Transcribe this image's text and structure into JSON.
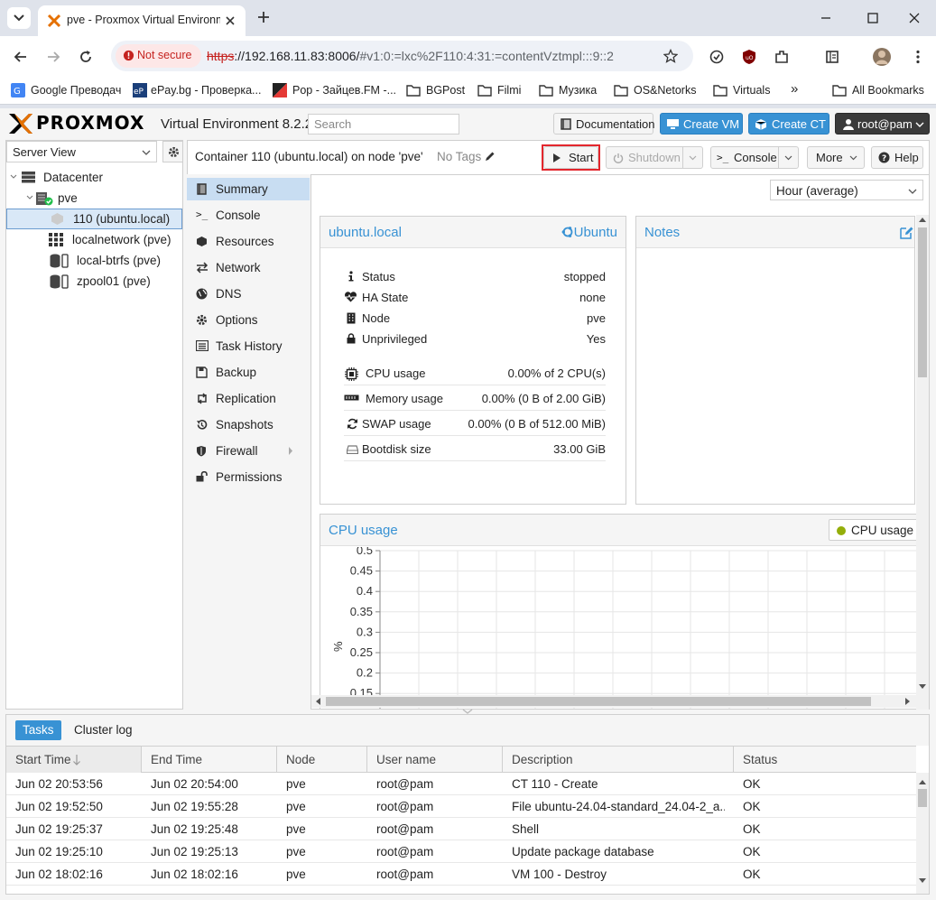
{
  "browser": {
    "tab_title": "pve - Proxmox Virtual Environm",
    "security_label": "Not secure",
    "url_scheme": "https",
    "url_host": "://192.168.11.83:8006/",
    "url_path": "#v1:0:=lxc%2F110:4:31:=contentVztmpl:::9::2",
    "bookmarks": [
      "Google Преводач",
      "ePay.bg - Проверка...",
      "Pop - Зайцев.FM -...",
      "BGPost",
      "Filmi",
      "Музика",
      "OS&Netorks",
      "Virtuals"
    ],
    "all_bookmarks": "All Bookmarks",
    "more_bookmarks": "»"
  },
  "header": {
    "logo": "PROXMOX",
    "version": "Virtual Environment 8.2.2",
    "search_placeholder": "Search",
    "documentation": "Documentation",
    "create_vm": "Create VM",
    "create_ct": "Create CT",
    "user": "root@pam"
  },
  "tree": {
    "view": "Server View",
    "datacenter": "Datacenter",
    "node": "pve",
    "items": [
      "110 (ubuntu.local)",
      "localnetwork (pve)",
      "local-btrfs (pve)",
      "zpool01 (pve)"
    ]
  },
  "toolbar": {
    "title": "Container 110 (ubuntu.local) on node 'pve'",
    "no_tags": "No Tags",
    "start": "Start",
    "shutdown": "Shutdown",
    "console": "Console",
    "more": "More",
    "help": "Help"
  },
  "menu": [
    "Summary",
    "Console",
    "Resources",
    "Network",
    "DNS",
    "Options",
    "Task History",
    "Backup",
    "Replication",
    "Snapshots",
    "Firewall",
    "Permissions"
  ],
  "summary": {
    "time_range": "Hour (average)",
    "panel_title": "ubuntu.local",
    "os": "Ubuntu",
    "notes_title": "Notes",
    "rows": [
      {
        "k": "Status",
        "v": "stopped"
      },
      {
        "k": "HA State",
        "v": "none"
      },
      {
        "k": "Node",
        "v": "pve"
      },
      {
        "k": "Unprivileged",
        "v": "Yes"
      }
    ],
    "usage": [
      {
        "k": "CPU usage",
        "v": "0.00% of 2 CPU(s)"
      },
      {
        "k": "Memory usage",
        "v": "0.00% (0 B of 2.00 GiB)"
      },
      {
        "k": "SWAP usage",
        "v": "0.00% (0 B of 512.00 MiB)"
      },
      {
        "k": "Bootdisk size",
        "v": "33.00 GiB"
      }
    ]
  },
  "chart_data": {
    "type": "line",
    "title": "CPU usage",
    "ylabel": "%",
    "yticks": [
      "0.5",
      "0.45",
      "0.4",
      "0.35",
      "0.3",
      "0.25",
      "0.2",
      "0.15"
    ],
    "ylim": [
      0.15,
      0.5
    ],
    "legend": "CPU usage",
    "series": [
      {
        "name": "CPU usage",
        "values": []
      }
    ],
    "colors": {
      "series": "#94ae0a"
    }
  },
  "tasks": {
    "tabs": [
      "Tasks",
      "Cluster log"
    ],
    "columns": [
      "Start Time",
      "End Time",
      "Node",
      "User name",
      "Description",
      "Status"
    ],
    "rows": [
      [
        "Jun 02 20:53:56",
        "Jun 02 20:54:00",
        "pve",
        "root@pam",
        "CT 110 - Create",
        "OK"
      ],
      [
        "Jun 02 19:52:50",
        "Jun 02 19:55:28",
        "pve",
        "root@pam",
        "File ubuntu-24.04-standard_24.04-2_a...",
        "OK"
      ],
      [
        "Jun 02 19:25:37",
        "Jun 02 19:25:48",
        "pve",
        "root@pam",
        "Shell",
        "OK"
      ],
      [
        "Jun 02 19:25:10",
        "Jun 02 19:25:13",
        "pve",
        "root@pam",
        "Update package database",
        "OK"
      ],
      [
        "Jun 02 18:02:16",
        "Jun 02 18:02:16",
        "pve",
        "root@pam",
        "VM 100 - Destroy",
        "OK"
      ]
    ]
  },
  "colors": {
    "accent": "#3892d4",
    "highlight": "#e3262d",
    "proxmox_orange": "#e57000"
  }
}
